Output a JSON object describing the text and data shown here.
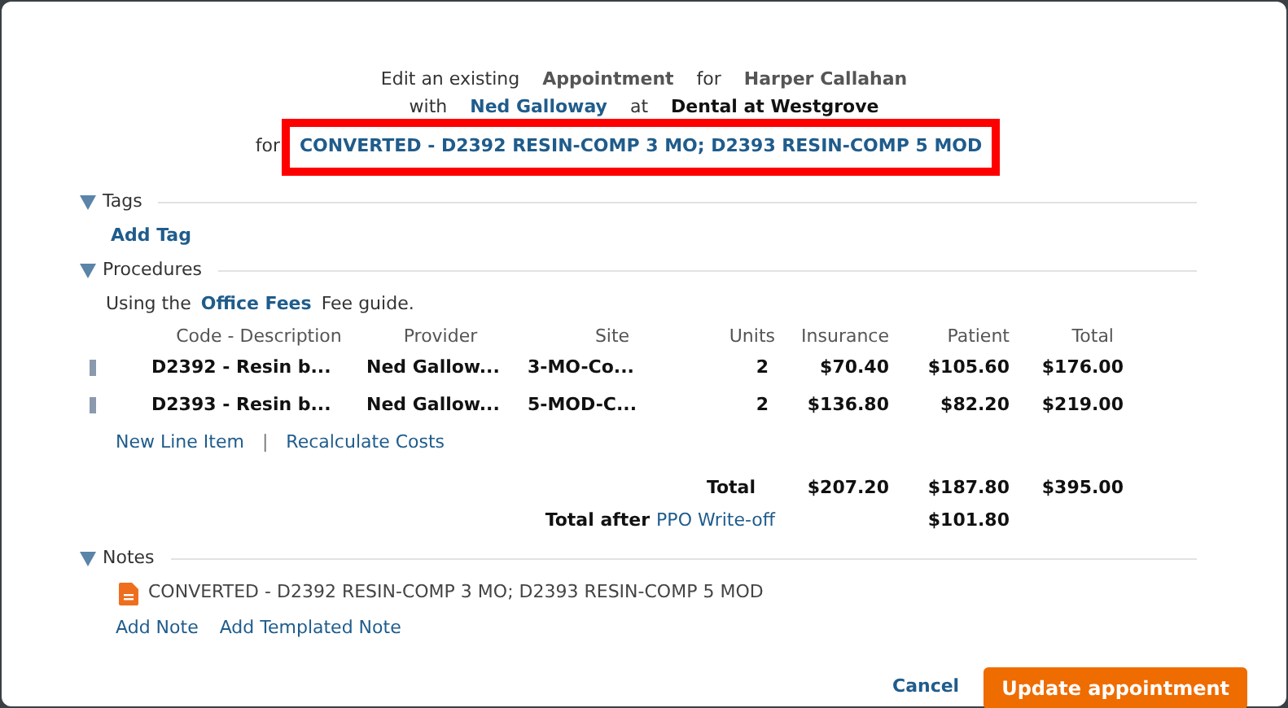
{
  "header": {
    "line_1": [
      {
        "text": "Edit an existing",
        "kind": "plain"
      },
      {
        "text": "Appointment",
        "kind": "bold"
      },
      {
        "text": "for",
        "kind": "plain"
      },
      {
        "text": "Harper Callahan",
        "kind": "bold"
      }
    ],
    "line_2": [
      {
        "text": "with",
        "kind": "plain"
      },
      {
        "text": "Ned Galloway",
        "kind": "link"
      },
      {
        "text": "at",
        "kind": "plain"
      },
      {
        "text": "Dental at Westgrove",
        "kind": "strong"
      }
    ],
    "for_label": "for",
    "subject": "CONVERTED - D2392 RESIN-COMP 3 MO; D2393 RESIN-COMP 5 MOD",
    "highlighted": true
  },
  "sections": {
    "tags": {
      "title": "Tags",
      "expanded": true,
      "add_link": "Add Tag"
    },
    "procedures": {
      "title": "Procedures",
      "expanded": true,
      "fee_guide": {
        "prefix": "Using the",
        "link": "Office Fees",
        "suffix": "Fee guide."
      },
      "columns": [
        "Code - Description",
        "Provider",
        "Site",
        "Units",
        "Insurance",
        "Patient",
        "Total"
      ],
      "rows": [
        {
          "cells": [
            "D2392 - Resin b...",
            "Ned Gallow...",
            "3-MO-Co...",
            "2",
            "$70.40",
            "$105.60",
            "$176.00"
          ]
        },
        {
          "cells": [
            "D2393 - Resin b...",
            "Ned Gallow...",
            "5-MOD-C...",
            "2",
            "$136.80",
            "$82.20",
            "$219.00"
          ]
        }
      ],
      "actions": [
        "New Line Item",
        "Recalculate Costs"
      ],
      "separator": "|",
      "total": {
        "label": "Total",
        "insurance": "$207.20",
        "patient": "$187.80",
        "total": "$395.00"
      },
      "total_after": {
        "label": "Total after",
        "link": "PPO Write-off",
        "patient": "$101.80"
      }
    },
    "notes": {
      "title": "Notes",
      "expanded": true,
      "items": [
        {
          "text": "CONVERTED - D2392 RESIN-COMP 3 MO; D2393 RESIN-COMP 5 MOD"
        }
      ],
      "actions": [
        "Add Note",
        "Add Templated Note"
      ]
    }
  },
  "footer": {
    "cancel": "Cancel",
    "submit": "Update appointment"
  }
}
